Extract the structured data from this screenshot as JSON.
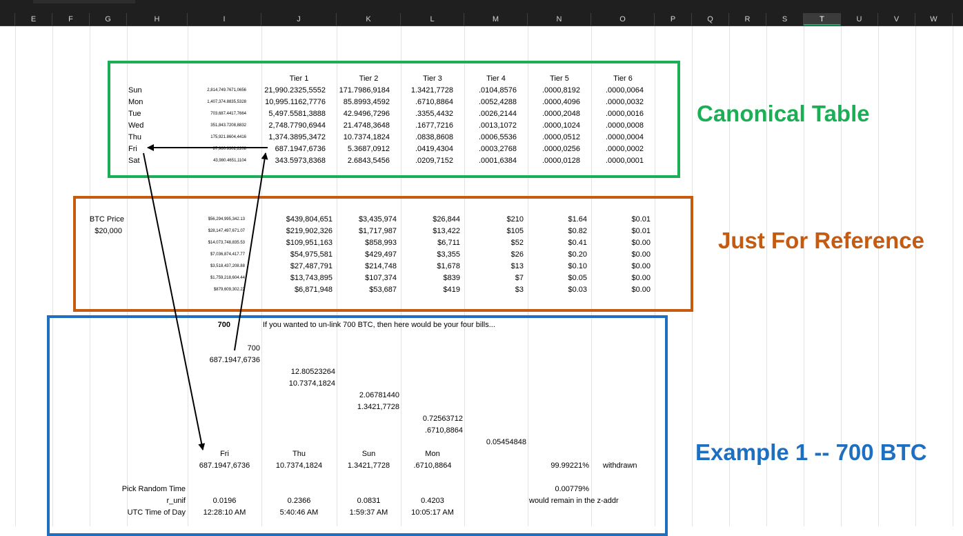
{
  "columns": [
    "E",
    "F",
    "G",
    "H",
    "I",
    "J",
    "K",
    "L",
    "M",
    "N",
    "O",
    "P",
    "Q",
    "R",
    "S",
    "T",
    "U",
    "V",
    "W"
  ],
  "selected_column": "T",
  "canonical": {
    "title": "Canonical Table",
    "tiers": [
      "Tier 1",
      "Tier 2",
      "Tier 3",
      "Tier 4",
      "Tier 5",
      "Tier 6"
    ],
    "rows": [
      {
        "day": "Sun",
        "total": "2,814,749.7671,0656",
        "vals": [
          "21,990.2325,5552",
          "171.7986,9184",
          "1.3421,7728",
          ".0104,8576",
          ".0000,8192",
          ".0000,0064"
        ]
      },
      {
        "day": "Mon",
        "total": "1,407,374.8835,5328",
        "vals": [
          "10,995.1162,7776",
          "85.8993,4592",
          ".6710,8864",
          ".0052,4288",
          ".0000,4096",
          ".0000,0032"
        ]
      },
      {
        "day": "Tue",
        "total": "703,687.4417,7664",
        "vals": [
          "5,497.5581,3888",
          "42.9496,7296",
          ".3355,4432",
          ".0026,2144",
          ".0000,2048",
          ".0000,0016"
        ]
      },
      {
        "day": "Wed",
        "total": "351,843.7208,8832",
        "vals": [
          "2,748.7790,6944",
          "21.4748,3648",
          ".1677,7216",
          ".0013,1072",
          ".0000,1024",
          ".0000,0008"
        ]
      },
      {
        "day": "Thu",
        "total": "175,921.8604,4416",
        "vals": [
          "1,374.3895,3472",
          "10.7374,1824",
          ".0838,8608",
          ".0006,5536",
          ".0000,0512",
          ".0000,0004"
        ]
      },
      {
        "day": "Fri",
        "total": "87,960.9302,2208",
        "vals": [
          "687.1947,6736",
          "5.3687,0912",
          ".0419,4304",
          ".0003,2768",
          ".0000,0256",
          ".0000,0002"
        ]
      },
      {
        "day": "Sat",
        "total": "43,980.4651,1104",
        "vals": [
          "343.5973,8368",
          "2.6843,5456",
          ".0209,7152",
          ".0001,6384",
          ".0000,0128",
          ".0000,0001"
        ]
      }
    ]
  },
  "reference": {
    "title": "Just For Reference",
    "btc_label": "BTC Price",
    "btc_price": "$20,000",
    "rows": [
      {
        "total": "$56,294,995,342.13",
        "vals": [
          "$439,804,651",
          "$3,435,974",
          "$26,844",
          "$210",
          "$1.64",
          "$0.01"
        ]
      },
      {
        "total": "$28,147,497,671.07",
        "vals": [
          "$219,902,326",
          "$1,717,987",
          "$13,422",
          "$105",
          "$0.82",
          "$0.01"
        ]
      },
      {
        "total": "$14,073,748,835.53",
        "vals": [
          "$109,951,163",
          "$858,993",
          "$6,711",
          "$52",
          "$0.41",
          "$0.00"
        ]
      },
      {
        "total": "$7,036,874,417.77",
        "vals": [
          "$54,975,581",
          "$429,497",
          "$3,355",
          "$26",
          "$0.20",
          "$0.00"
        ]
      },
      {
        "total": "$3,518,437,208.88",
        "vals": [
          "$27,487,791",
          "$214,748",
          "$1,678",
          "$13",
          "$0.10",
          "$0.00"
        ]
      },
      {
        "total": "$1,759,218,604.44",
        "vals": [
          "$13,743,895",
          "$107,374",
          "$839",
          "$7",
          "$0.05",
          "$0.00"
        ]
      },
      {
        "total": "$879,609,302.22",
        "vals": [
          "$6,871,948",
          "$53,687",
          "$419",
          "$3",
          "$0.03",
          "$0.00"
        ]
      }
    ]
  },
  "example": {
    "title": "Example 1 -- 700 BTC",
    "amount": "700",
    "description": "If you wanted to un-link 700 BTC, then here would be your four bills...",
    "start_value": "700",
    "first_bill": "687.1947,6736",
    "remainder_1": "12.80523264",
    "second_bill": "10.7374,1824",
    "remainder_2": "2.06781440",
    "third_bill": "1.3421,7728",
    "remainder_3": "0.72563712",
    "fourth_bill": ".6710,8864",
    "remainder_4": "0.05454848",
    "days": [
      "Fri",
      "Thu",
      "Sun",
      "Mon"
    ],
    "bills": [
      "687.1947,6736",
      "10.7374,1824",
      "1.3421,7728",
      ".6710,8864"
    ],
    "withdrawn_pct": "99.99221%",
    "withdrawn_label": "withdrawn",
    "pick_label": "Pick Random Time",
    "remain_pct": "0.00779%",
    "runif_label": "r_unif",
    "runif": [
      "0.0196",
      "0.2366",
      "0.0831",
      "0.4203"
    ],
    "remain_label": "would remain in the z-addr",
    "utc_label": "UTC Time of Day",
    "times": [
      "12:28:10 AM",
      "5:40:46 AM",
      "1:59:37 AM",
      "10:05:17 AM"
    ]
  },
  "colors": {
    "canonical": "#1aaf54",
    "reference": "#c55a11",
    "example": "#1f6fc1",
    "header_bg": "#1f1f1f",
    "selected_header_underline": "#21a366"
  }
}
